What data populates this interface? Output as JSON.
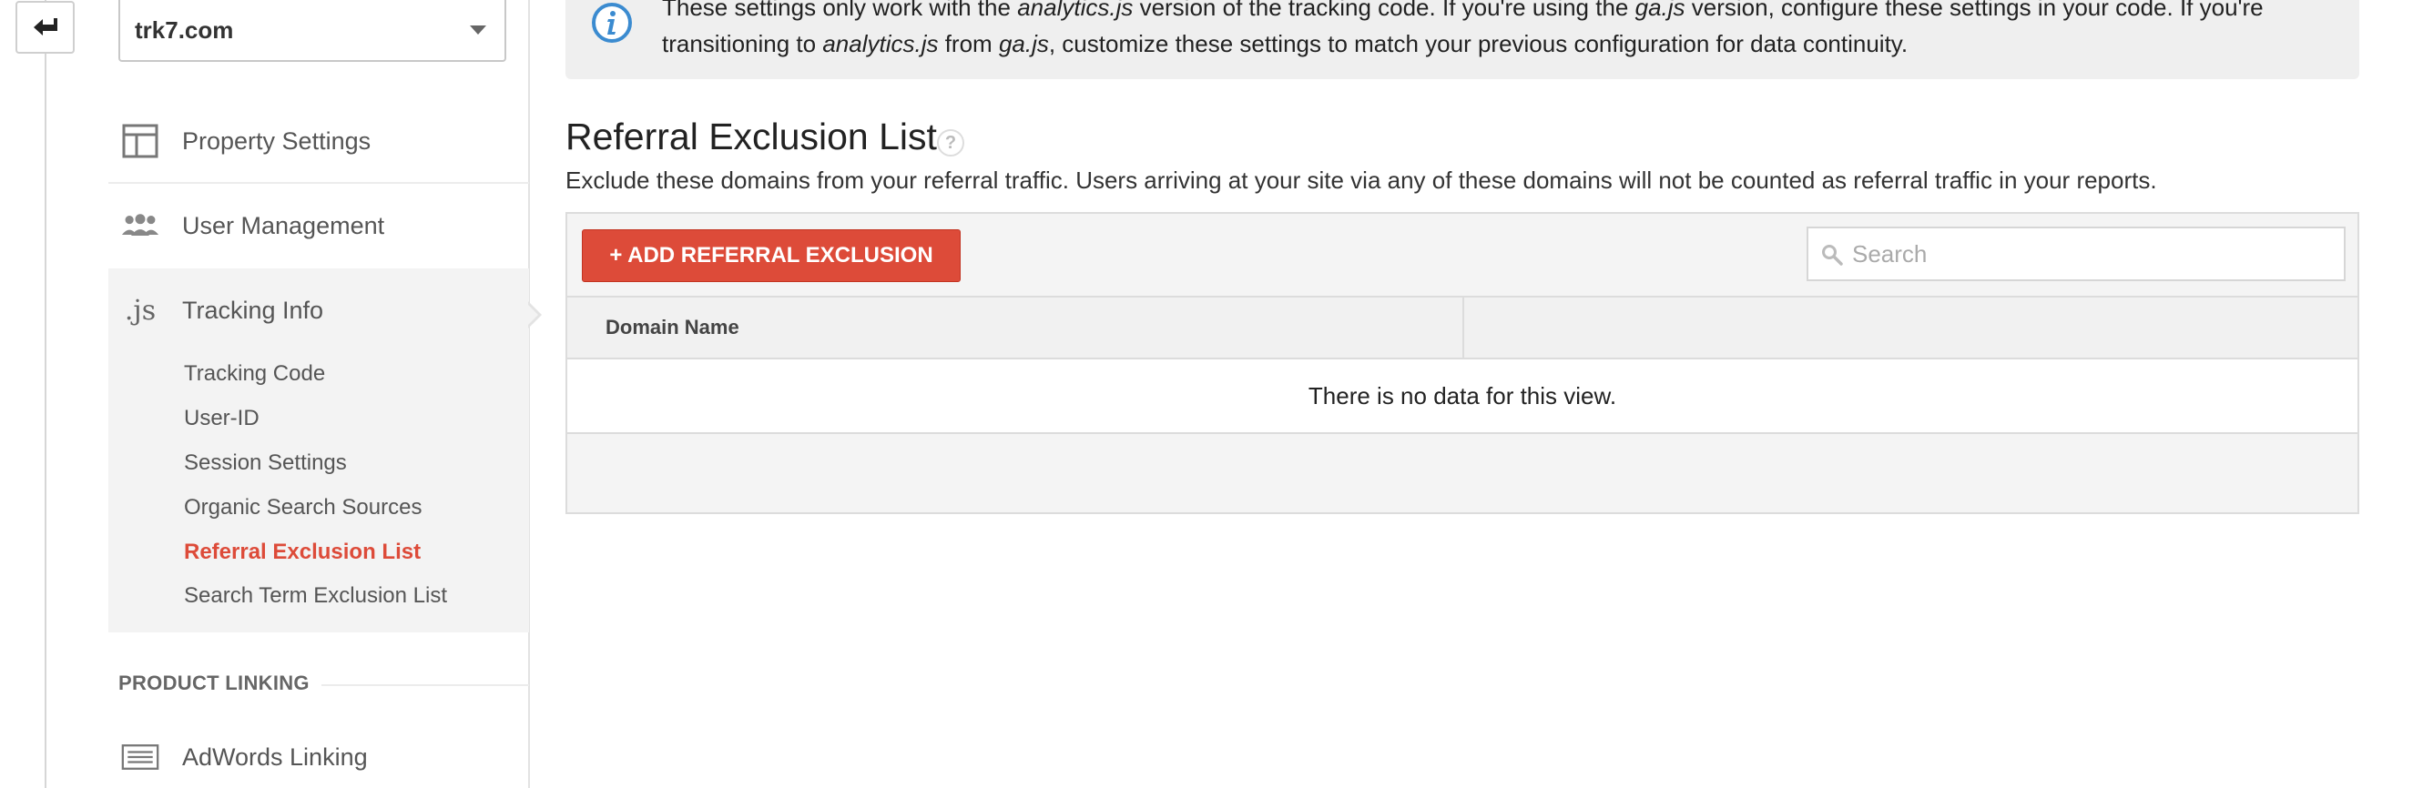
{
  "nav": {
    "back_icon": "back-arrow-icon",
    "property": "trk7.com",
    "items": [
      {
        "label": "Property Settings",
        "icon": "property-settings-icon"
      },
      {
        "label": "User Management",
        "icon": "users-icon"
      },
      {
        "label": "Tracking Info",
        "icon_text": ".js",
        "icon": "js-icon"
      }
    ],
    "tracking_subitems": [
      {
        "label": "Tracking Code"
      },
      {
        "label": "User-ID"
      },
      {
        "label": "Session Settings"
      },
      {
        "label": "Organic Search Sources"
      },
      {
        "label": "Referral Exclusion List",
        "active": true
      },
      {
        "label": "Search Term Exclusion List"
      }
    ],
    "section_product_linking": "PRODUCT LINKING",
    "adwords": {
      "label": "AdWords Linking",
      "icon": "adwords-icon"
    }
  },
  "info": {
    "line1_a": "These settings only work with the ",
    "line1_b": "analytics.js",
    "line1_c": " version of the tracking code. If you're using the ",
    "line1_d": "ga.js",
    "line1_e": " version, configure these settings in your code. If you're",
    "line2_a": "transitioning to ",
    "line2_b": "analytics.js",
    "line2_c": " from ",
    "line2_d": "ga.js",
    "line2_e": ", customize these settings to match your previous configuration for data continuity."
  },
  "main": {
    "title": "Referral Exclusion List",
    "help": "?",
    "description": "Exclude these domains from your referral traffic. Users arriving at your site via any of these domains will not be counted as referral traffic in your reports."
  },
  "table": {
    "add_button": "+ ADD REFERRAL EXCLUSION",
    "search_placeholder": "Search",
    "columns": [
      "Domain Name",
      ""
    ],
    "empty_message": "There is no data for this view."
  },
  "colors": {
    "accent_red": "#dd4b39",
    "info_blue": "#3b8bd0"
  }
}
